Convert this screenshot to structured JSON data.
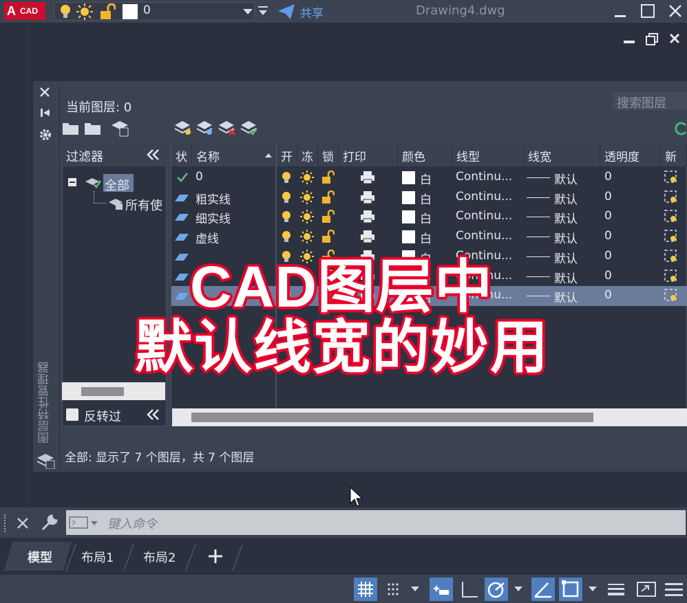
{
  "title_bar": {
    "logo_letter": "A",
    "logo_text": "CAD",
    "layer_value": "0",
    "share_label": "共享",
    "document": "Drawing4.dwg"
  },
  "palette": {
    "vertical_title": "图层特性管理器",
    "current_layer": "当前图层: 0",
    "search_label": "搜索图层",
    "filter_header": "过滤器",
    "tree_all": "全部",
    "tree_used": "所有使",
    "invert_label": "反转过",
    "status_text": "全部: 显示了 7 个图层，共 7 个图层",
    "columns": [
      "状",
      "名称",
      "开",
      "冻",
      "锁",
      "打印",
      "颜色",
      "线型",
      "线宽",
      "透明度",
      "新"
    ],
    "rows": [
      {
        "name": "0",
        "color": "白",
        "linetype": "Continu...",
        "lineweight": "默认",
        "transparency": "0",
        "current": true
      },
      {
        "name": "粗实线",
        "color": "白",
        "linetype": "Continu...",
        "lineweight": "默认",
        "transparency": "0"
      },
      {
        "name": "细实线",
        "color": "白",
        "linetype": "Continu...",
        "lineweight": "默认",
        "transparency": "0"
      },
      {
        "name": "虚线",
        "color": "白",
        "linetype": "Continu...",
        "lineweight": "默认",
        "transparency": "0"
      },
      {
        "name": "",
        "color": "白",
        "linetype": "Continu...",
        "lineweight": "默认",
        "transparency": "0"
      },
      {
        "name": "",
        "color": "白",
        "linetype": "Continu...",
        "lineweight": "默认",
        "transparency": "0"
      },
      {
        "name": "",
        "color": "白",
        "linetype": "Continu...",
        "lineweight": "默认",
        "transparency": "0",
        "selected": true
      }
    ]
  },
  "command": {
    "placeholder": "键入命令"
  },
  "tabs": [
    "模型",
    "布局1",
    "布局2"
  ],
  "caption": {
    "line1": "CAD图层中",
    "line2": "默认线宽的妙用"
  },
  "colors": {
    "accent": "#4f7fc0",
    "caption_outline": "#e8002a",
    "selected_row": "#6a7b9b"
  }
}
